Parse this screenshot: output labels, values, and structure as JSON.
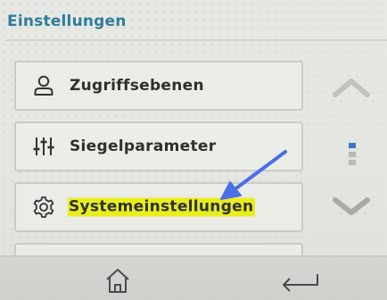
{
  "header": {
    "title": "Einstellungen",
    "accent_color": "#2f7d9e"
  },
  "menu": {
    "items": [
      {
        "label": "Zugriffsebenen",
        "icon": "user-icon",
        "highlighted": false
      },
      {
        "label": "Siegelparameter",
        "icon": "sliders-icon",
        "highlighted": false
      },
      {
        "label": "Systemeinstellungen",
        "icon": "gear-icon",
        "highlighted": true
      }
    ],
    "highlight_color": "#e8ee1c"
  },
  "scroll": {
    "up_icon": "chevron-up-icon",
    "down_icon": "chevron-down-icon",
    "indicator_active_color": "#3a78c8",
    "indicator_inactive_color": "#b9bab5"
  },
  "footer": {
    "home_icon": "home-icon",
    "back_icon": "return-arrow-icon"
  },
  "annotation": {
    "icon": "pointer-arrow-icon",
    "color": "#4a6fe8"
  }
}
